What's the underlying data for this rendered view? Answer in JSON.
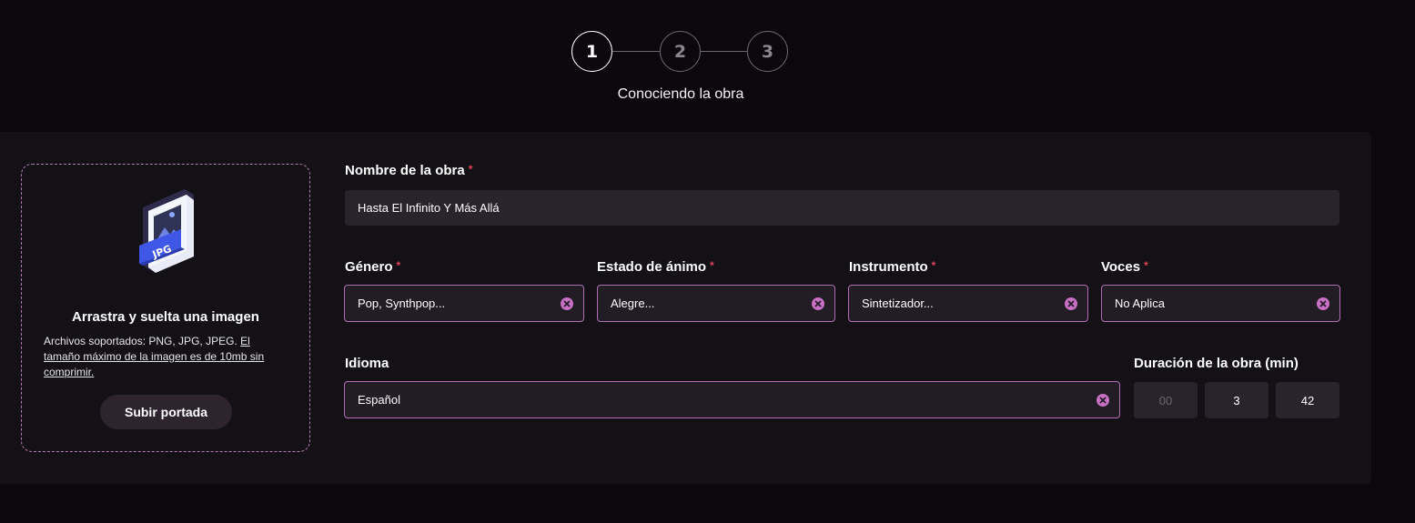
{
  "stepper": {
    "steps": [
      "1",
      "2",
      "3"
    ],
    "active": 1,
    "caption": "Conociendo la obra"
  },
  "upload": {
    "icon": "jpg-file-icon",
    "icon_badge": "JPG",
    "title": "Arrastra y suelta una imagen",
    "desc_prefix": "Archivos soportados: PNG, JPG, JPEG.",
    "desc_link": "El tamaño máximo de la imagen es de 10mb sin comprimir.",
    "button": "Subir portada"
  },
  "form": {
    "name": {
      "label": "Nombre de la obra",
      "required": "*",
      "value": "Hasta El Infinito Y Más Allá"
    },
    "genre": {
      "label": "Género",
      "required": "*",
      "value": "Pop, Synthpop..."
    },
    "mood": {
      "label": "Estado de ánimo",
      "required": "*",
      "value": "Alegre..."
    },
    "instrument": {
      "label": "Instrumento",
      "required": "*",
      "value": "Sintetizador..."
    },
    "voices": {
      "label": "Voces",
      "required": "*",
      "value": "No Aplica"
    },
    "language": {
      "label": "Idioma",
      "value": "Español"
    },
    "duration": {
      "label": "Duración de la obra (min)",
      "hours_placeholder": "00",
      "minutes": "3",
      "seconds": "42"
    }
  },
  "colors": {
    "background": "#0b070c",
    "card": "#141116",
    "accent": "#b36db5",
    "required": "#e0455a",
    "jpg_badge": "#3f57e6"
  }
}
